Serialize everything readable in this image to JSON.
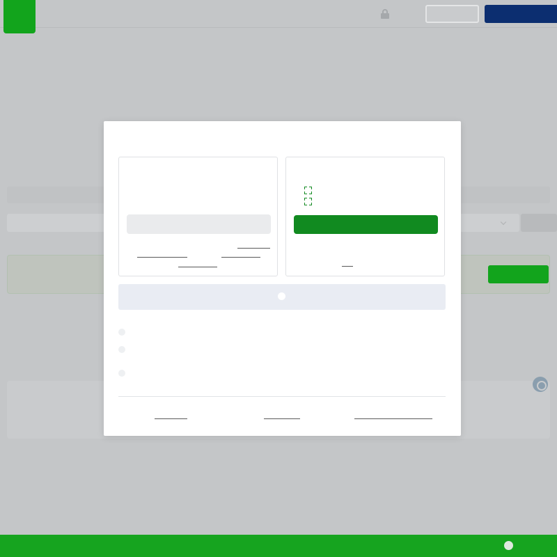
{
  "colors": {
    "overlay_bg": "#c4c6c8",
    "brand_green": "#12a41c",
    "primary_button": "#118a20",
    "navy": "#0c2e70",
    "modal_bg": "#ffffff",
    "secondary_option_bg": "#e9ecf3"
  },
  "background": {
    "header": {
      "logo_icon": "brand-logo",
      "lock_icon": "lock-icon",
      "login_label": "",
      "signup_label": ""
    },
    "help_icon": "help-icon",
    "footer_icon": "chat-icon"
  },
  "modal": {
    "title": "",
    "left_panel": {
      "heading": "",
      "description": "",
      "button_label": "",
      "fine_print": ""
    },
    "right_panel": {
      "heading": "",
      "features": [
        {
          "icon": "check-icon",
          "text": ""
        },
        {
          "icon": "check-icon",
          "text": ""
        }
      ],
      "button_label": "",
      "fine_print": ""
    },
    "secondary_option": {
      "icon": "circle-icon",
      "label": ""
    },
    "bullets": [
      {
        "text": ""
      },
      {
        "text": ""
      },
      {
        "text": ""
      }
    ],
    "footer_links": [
      {
        "label": ""
      },
      {
        "label": ""
      },
      {
        "label": ""
      }
    ]
  }
}
